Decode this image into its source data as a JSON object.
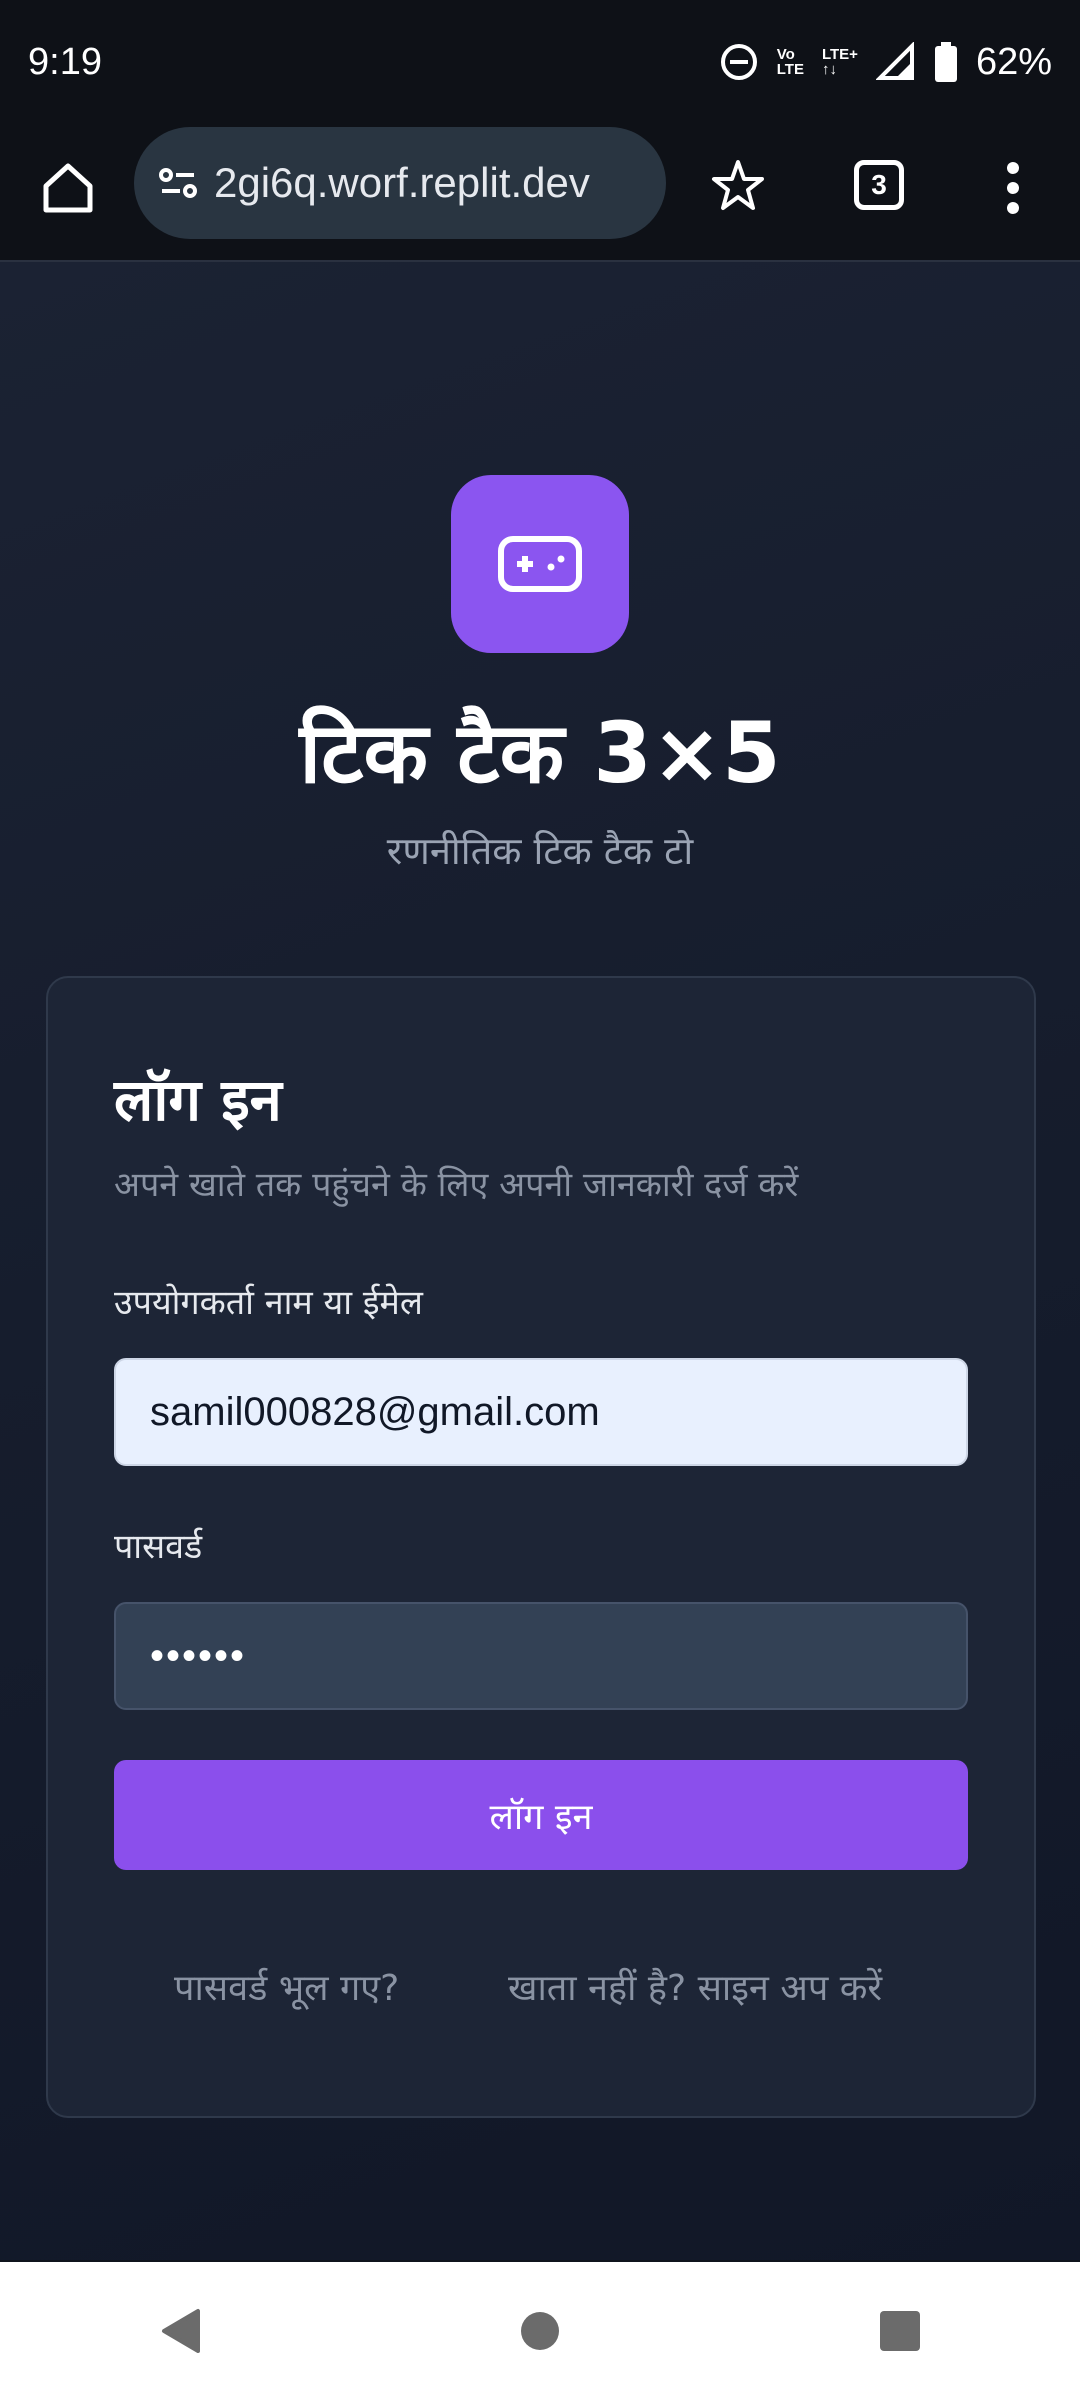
{
  "status_bar": {
    "time": "9:19",
    "volte_top": "Vo",
    "volte_bottom": "LTE",
    "lte_plus": "LTE+",
    "battery": "62%"
  },
  "browser": {
    "url": "2gi6q.worf.replit.dev",
    "tab_count": "3"
  },
  "app": {
    "title": "टिक टैक 3×5",
    "subtitle": "रणनीतिक टिक टैक टो",
    "accent": "#8b55f0"
  },
  "login_card": {
    "heading": "लॉग इन",
    "description": "अपने खाते तक पहुंचने के लिए अपनी जानकारी दर्ज करें",
    "username_label": "उपयोगकर्ता नाम या ईमेल",
    "username_value": "samil000828@gmail.com",
    "password_label": "पासवर्ड",
    "password_value": "••••••",
    "submit_label": "लॉग इन",
    "forgot_link": "पासवर्ड भूल गए?",
    "signup_link": "खाता नहीं है? साइन अप करें"
  },
  "icons": {
    "home": "home-icon",
    "site_info": "tune-icon",
    "bookmark": "star-icon",
    "menu": "more-vert-icon",
    "app": "gamepad-icon",
    "nav_back": "back-triangle-icon",
    "nav_home": "home-circle-icon",
    "nav_recents": "recents-square-icon"
  }
}
